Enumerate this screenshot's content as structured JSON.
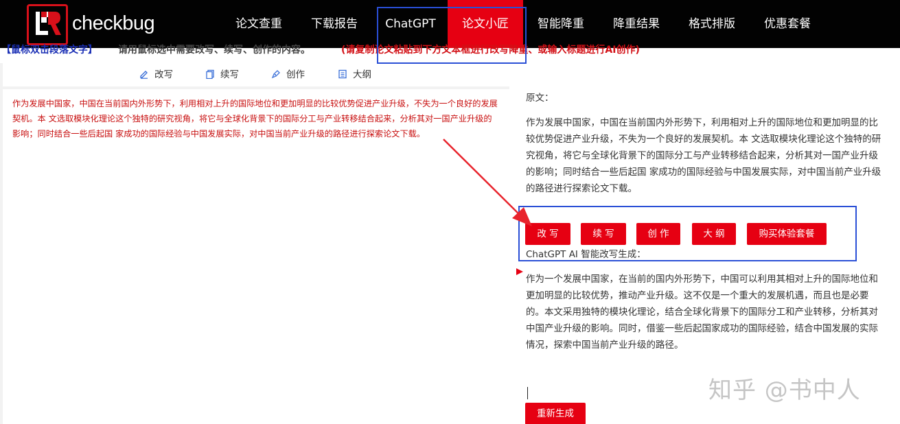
{
  "brand": {
    "name": "checkbug"
  },
  "nav": {
    "items": [
      {
        "label": "论文查重"
      },
      {
        "label": "下载报告"
      },
      {
        "label": "ChatGPT"
      },
      {
        "label": "论文小匠",
        "active": true
      },
      {
        "label": "智能降重"
      },
      {
        "label": "降重结果"
      },
      {
        "label": "格式排版"
      },
      {
        "label": "优惠套餐"
      }
    ]
  },
  "hint": {
    "blue": "【鼠标双击段落文字】",
    "grey": "请用鼠标选中需要改写、续写、创作的内容。",
    "red": "(请复制论文粘贴到下方文本框进行改写降重、或输入标题进行AI创作)"
  },
  "toolbar": {
    "tools": [
      {
        "label": "改写",
        "icon": "pencil-icon"
      },
      {
        "label": "续写",
        "icon": "copy-icon"
      },
      {
        "label": "创作",
        "icon": "pen-nib-icon"
      },
      {
        "label": "大纲",
        "icon": "outline-icon"
      }
    ]
  },
  "editor": {
    "text": "作为发展中国家，中国在当前国内外形势下，利用相对上升的国际地位和更加明显的比较优势促进产业升级，不失为一个良好的发展契机。本 文选取模块化理论这个独特的研究视角，将它与全球化背景下的国际分工与产业转移结合起来，分析其对一国产业升级的影响；同时结合一些后起国 家成功的国际经验与中国发展实际，对中国当前产业升级的路径进行探索论文下载。"
  },
  "result_panel": {
    "origin_label": "原文：",
    "origin_text": "作为发展中国家，中国在当前国内外形势下，利用相对上升的国际地位和更加明显的比较优势促进产业升级，不失为一个良好的发展契机。本 文选取模块化理论这个独特的研究视角，将它与全球化背景下的国际分工与产业转移结合起来，分析其对一国产业升级的影响；同时结合一些后起国 家成功的国际经验与中国发展实际，对中国当前产业升级的路径进行探索论文下载。",
    "buttons": {
      "rewrite": "改 写",
      "continue": "续 写",
      "create": "创 作",
      "outline": "大 纲",
      "buy": "购买体验套餐"
    },
    "ai_label": "ChatGPT AI 智能改写生成：",
    "result_text": "作为一个发展中国家，在当前的国内外形势下，中国可以利用其相对上升的国际地位和更加明显的比较优势，推动产业升级。这不仅是一个重大的发展机遇，而且也是必要的。本文采用独特的模块化理论，结合全球化背景下的国际分工和产业转移，分析其对中国产业升级的影响。同时，借鉴一些后起国家成功的国际经验，结合中国发展的实际情况，探索中国当前产业升级的路径。",
    "regenerate": "重新生成"
  },
  "watermark": "知乎 @书中人",
  "colors": {
    "brand_red": "#e60012",
    "nav_bg": "#020202",
    "highlight_blue": "#2a4fd6",
    "editor_text": "#c80f0f"
  }
}
